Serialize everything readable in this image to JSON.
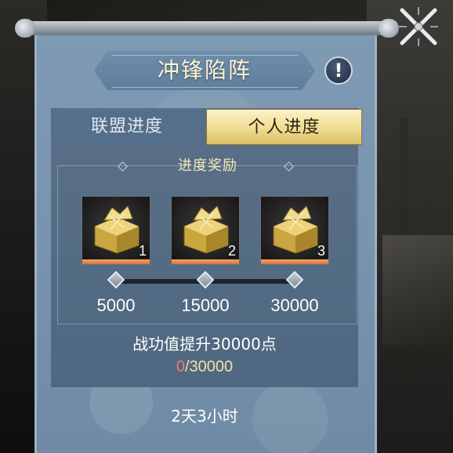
{
  "title": "冲锋陷阵",
  "info_icon": "exclamation-icon",
  "close_icon": "close-icon",
  "tabs": [
    {
      "label": "联盟进度",
      "active": false
    },
    {
      "label": "个人进度",
      "active": true
    }
  ],
  "reward_section_title": "进度奖励",
  "rewards": [
    {
      "icon": "gold-treasure-icon",
      "count": "1",
      "threshold": "5000"
    },
    {
      "icon": "gold-treasure-icon",
      "count": "2",
      "threshold": "15000"
    },
    {
      "icon": "gold-treasure-icon",
      "count": "3",
      "threshold": "30000"
    }
  ],
  "description": "战功值提升30000点",
  "progress": {
    "current": "0",
    "total": "/30000"
  },
  "time_remaining": "2天3小时",
  "colors": {
    "accent_gold": "#f0dc92",
    "progress_current": "#f07b7b",
    "panel": "#7894ae"
  }
}
